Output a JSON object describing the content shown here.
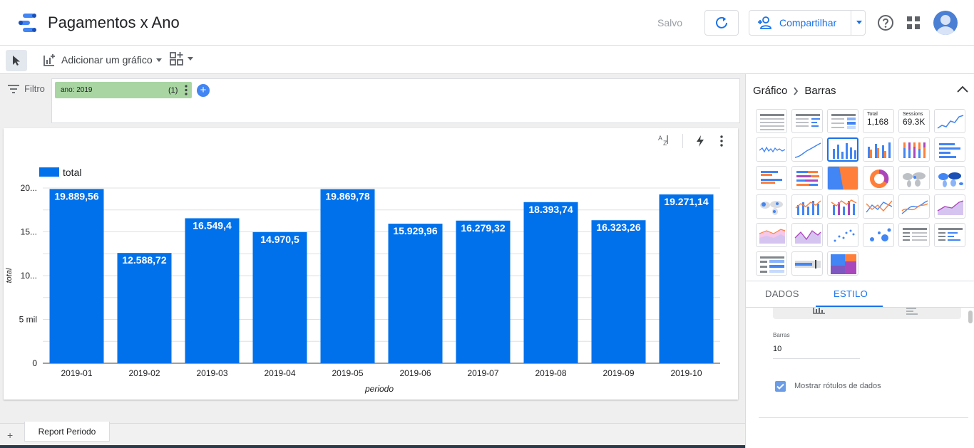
{
  "header": {
    "title": "Pagamentos x Ano",
    "saved_label": "Salvo",
    "share_label": "Compartilhar"
  },
  "toolbar": {
    "add_chart_label": "Adicionar um gráfico"
  },
  "filter": {
    "label": "Filtro",
    "chip_label": "ano: 2019",
    "chip_count": "(1)"
  },
  "colors": {
    "bar": "#0071ea",
    "accent": "#1a73e8",
    "chip": "#a8d5a2"
  },
  "chart_data": {
    "type": "bar",
    "legend": "total",
    "categories": [
      "2019-01",
      "2019-02",
      "2019-03",
      "2019-04",
      "2019-05",
      "2019-06",
      "2019-07",
      "2019-08",
      "2019-09",
      "2019-10"
    ],
    "values": [
      19889.56,
      12588.72,
      16549.4,
      14970.5,
      19869.78,
      15929.96,
      16279.32,
      18393.74,
      16323.26,
      19271.14
    ],
    "data_labels": [
      "19.889,56",
      "12.588,72",
      "16.549,4",
      "14.970,5",
      "19.869,78",
      "15.929,96",
      "16.279,32",
      "18.393,74",
      "16.323,26",
      "19.271,14"
    ],
    "yticks": [
      0,
      5000,
      10000,
      15000,
      20000
    ],
    "ytick_labels": [
      "0",
      "5 mil",
      "10...",
      "15...",
      "20..."
    ],
    "ylim": [
      0,
      20000
    ],
    "xlabel": "periodo",
    "ylabel": "total",
    "grid": true,
    "legend_position": "top-left"
  },
  "panel": {
    "crumb_root": "Gráfico",
    "crumb_leaf": "Barras",
    "scorecard_total_label": "Total",
    "scorecard_total_value": "1,168",
    "scorecard_sessions_label": "Sessions",
    "scorecard_sessions_value": "69.3K",
    "tab_data": "DADOS",
    "tab_style": "ESTILO",
    "bars_label": "Barras",
    "bars_value": "10",
    "show_labels": "Mostrar rótulos de dados"
  },
  "pages": {
    "add_label": "+",
    "tab_label": "Report Periodo"
  }
}
